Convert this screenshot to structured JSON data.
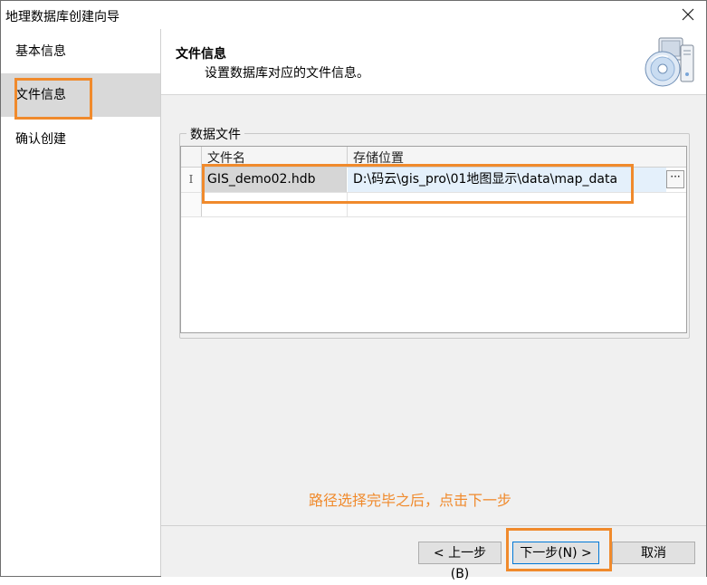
{
  "window": {
    "title": "地理数据库创建向导"
  },
  "sidebar": {
    "items": [
      {
        "label": "基本信息"
      },
      {
        "label": "文件信息"
      },
      {
        "label": "确认创建"
      }
    ]
  },
  "header": {
    "title": "文件信息",
    "description": "设置数据库对应的文件信息。"
  },
  "group": {
    "legend": "数据文件"
  },
  "grid": {
    "columns": [
      "文件名",
      "存储位置"
    ],
    "row_indicator": "I",
    "rows": [
      {
        "file_name": "GIS_demo02.hdb",
        "path": "D:\\码云\\gis_pro\\01地图显示\\data\\map_data",
        "browse": "···"
      }
    ]
  },
  "hint": "路径选择完毕之后，点击下一步",
  "footer": {
    "prev_label": "< 上一步(B)",
    "next_label": "下一步(N) >",
    "cancel_label": "取消"
  },
  "colors": {
    "highlight": "#f08a2c",
    "primary_border": "#0078d7"
  }
}
